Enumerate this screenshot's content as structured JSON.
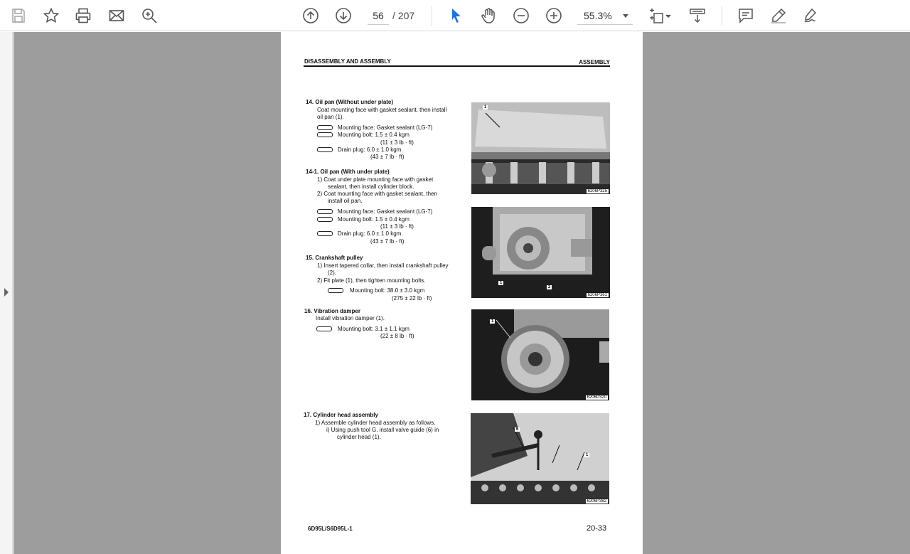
{
  "toolbar": {
    "icons": [
      "save-icon",
      "bookmark-star-icon",
      "print-icon",
      "email-icon",
      "zoom-search-icon",
      "page-up-icon",
      "page-down-icon",
      "select-cursor-icon",
      "hand-pan-icon",
      "zoom-out-icon",
      "zoom-in-icon",
      "fit-page-icon",
      "scroll-mode-icon",
      "comment-icon",
      "highlight-pen-icon",
      "sign-pen-icon"
    ],
    "page_current": "56",
    "page_total": "/ 207",
    "zoom": "55.3%"
  },
  "colors": {
    "select_accent": "#1a73e8",
    "viewer_bg": "#9d9d9d"
  },
  "document": {
    "header_left": "DISASSEMBLY AND ASSEMBLY",
    "header_right": "ASSEMBLY",
    "footer_left": "6D95L/S6D95L-1",
    "footer_right": "20-33",
    "s14": {
      "title": "14. Oil pan (Without under plate)",
      "line1": "Coat mounting face with gasket sealant, then install",
      "line2": "oil pan (1).",
      "mf": "Mounting face:  Gasket sealant (LG-7)",
      "mb": "Mounting bolt:  1.5 ± 0.4 kgm",
      "mb2": "(11 ± 3 lb · ft)",
      "dp": "Drain plug:  6.0 ± 1.0 kgm",
      "dp2": "(43 ± 7 lb · ft)"
    },
    "s141": {
      "title": "14-1. Oil pan (With under plate)",
      "i1a": "1)  Coat under plate mounting face with gasket",
      "i1b": "sealant, then install cylinder block.",
      "i2a": "2)  Coat mounting face with gasket sealant, then",
      "i2b": "install oil pan.",
      "mf": "Mounting face:  Gasket sealant (LG-7)",
      "mb": "Mounting bolt:  1.5 ± 0.4 kgm",
      "mb2": "(11 ± 3 lb · ft)",
      "dp": "Drain plug:  6.0 ± 1.0 kgm",
      "dp2": "(43 ± 7 lb · ft)"
    },
    "s15": {
      "title": "15. Crankshaft pulley",
      "i1a": "1)  Insert tapered collar, then install crankshaft pulley",
      "i1b": "(2).",
      "i2": "2)  Fit plate (1), then tighten mounting bolts.",
      "mb": "Mounting bolt:  38.0 ± 3.0 kgm",
      "mb2": "(275 ± 22 lb · ft)"
    },
    "s16": {
      "title": "16. Vibration damper",
      "line1": "Install vibration damper (1).",
      "mb": "Mounting bolt:  3.1 ± 1.1 kgm",
      "mb2": "(22 ± 8 lb · ft)"
    },
    "s17": {
      "title": "17. Cylinder head assembly",
      "i1": "1)  Assemble cylinder head assembly as follows.",
      "i1a": "i)   Using push tool G, install valve guide (6) in",
      "i1b": "cylinder head (1)."
    },
    "photos": {
      "p1_tag": "6206P325",
      "p1_num": "1",
      "p2_tag": "6206P361",
      "p2_num1": "1",
      "p2_num2": "2",
      "p3_tag": "6206P320",
      "p3_num": "1",
      "p4_tag": "6206P382",
      "p4_num1": "6",
      "p4_num2": "1"
    }
  }
}
